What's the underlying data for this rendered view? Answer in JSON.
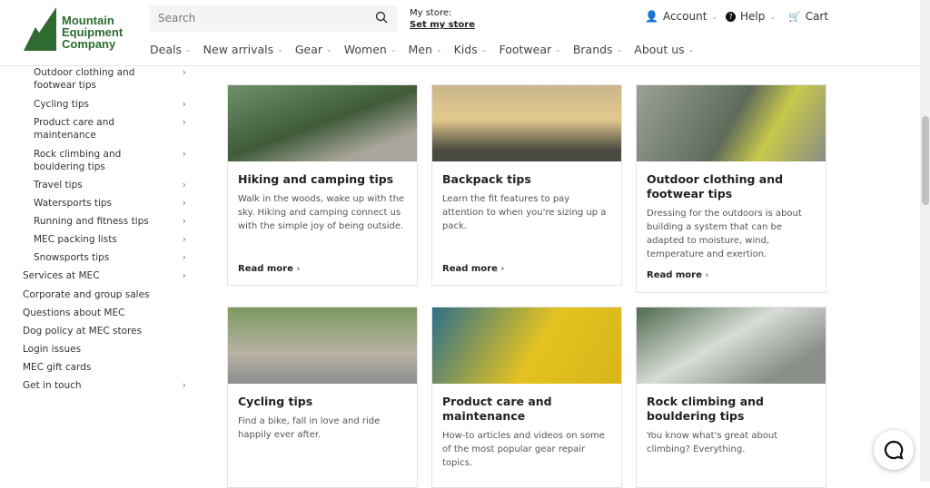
{
  "header": {
    "logo": "Mountain Equipment Company",
    "logo_lines": [
      "Mountain",
      "Equipment",
      "Company"
    ],
    "search_placeholder": "Search",
    "store_label": "My store:",
    "store_link": "Set my store",
    "account": "Account",
    "help": "Help",
    "cart": "Cart",
    "brand_color": "#2e6b30"
  },
  "nav": [
    "Deals",
    "New arrivals",
    "Gear",
    "Women",
    "Men",
    "Kids",
    "Footwear",
    "Brands",
    "About us"
  ],
  "sidebar": [
    {
      "label": "Outdoor clothing and footwear tips",
      "sub": true,
      "arrow": true
    },
    {
      "label": "Cycling tips",
      "sub": true,
      "arrow": true
    },
    {
      "label": "Product care and maintenance",
      "sub": true,
      "arrow": true
    },
    {
      "label": "Rock climbing and bouldering tips",
      "sub": true,
      "arrow": true
    },
    {
      "label": "Travel tips",
      "sub": true,
      "arrow": true
    },
    {
      "label": "Watersports tips",
      "sub": true,
      "arrow": true
    },
    {
      "label": "Running and fitness tips",
      "sub": true,
      "arrow": true
    },
    {
      "label": "MEC packing lists",
      "sub": true,
      "arrow": true
    },
    {
      "label": "Snowsports tips",
      "sub": true,
      "arrow": true
    },
    {
      "label": "Services at MEC",
      "sub": false,
      "arrow": true
    },
    {
      "label": "Corporate and group sales",
      "sub": false,
      "arrow": false
    },
    {
      "label": "Questions about MEC",
      "sub": false,
      "arrow": false
    },
    {
      "label": "Dog policy at MEC stores",
      "sub": false,
      "arrow": false
    },
    {
      "label": "Login issues",
      "sub": false,
      "arrow": false
    },
    {
      "label": "MEC gift cards",
      "sub": false,
      "arrow": false
    },
    {
      "label": "Get in touch",
      "sub": false,
      "arrow": true
    }
  ],
  "cards": [
    {
      "title": "Hiking and camping tips",
      "desc": "Walk in the woods, wake up with the sky. Hiking and camping connect us with the simple joy of being outside.",
      "more": "Read more"
    },
    {
      "title": "Backpack tips",
      "desc": "Learn the fit features to pay attention to when you're sizing up a pack.",
      "more": "Read more"
    },
    {
      "title": "Outdoor clothing and footwear tips",
      "desc": "Dressing for the outdoors is about building a system that can be adapted to moisture, wind, temperature and exertion.",
      "more": "Read more"
    },
    {
      "title": "Cycling tips",
      "desc": "Find a bike, fall in love and ride happily ever after."
    },
    {
      "title": "Product care and maintenance",
      "desc": "How-to articles and videos on some of the most popular gear repair topics."
    },
    {
      "title": "Rock climbing and bouldering tips",
      "desc": "You know what's great about climbing? Everything."
    }
  ]
}
